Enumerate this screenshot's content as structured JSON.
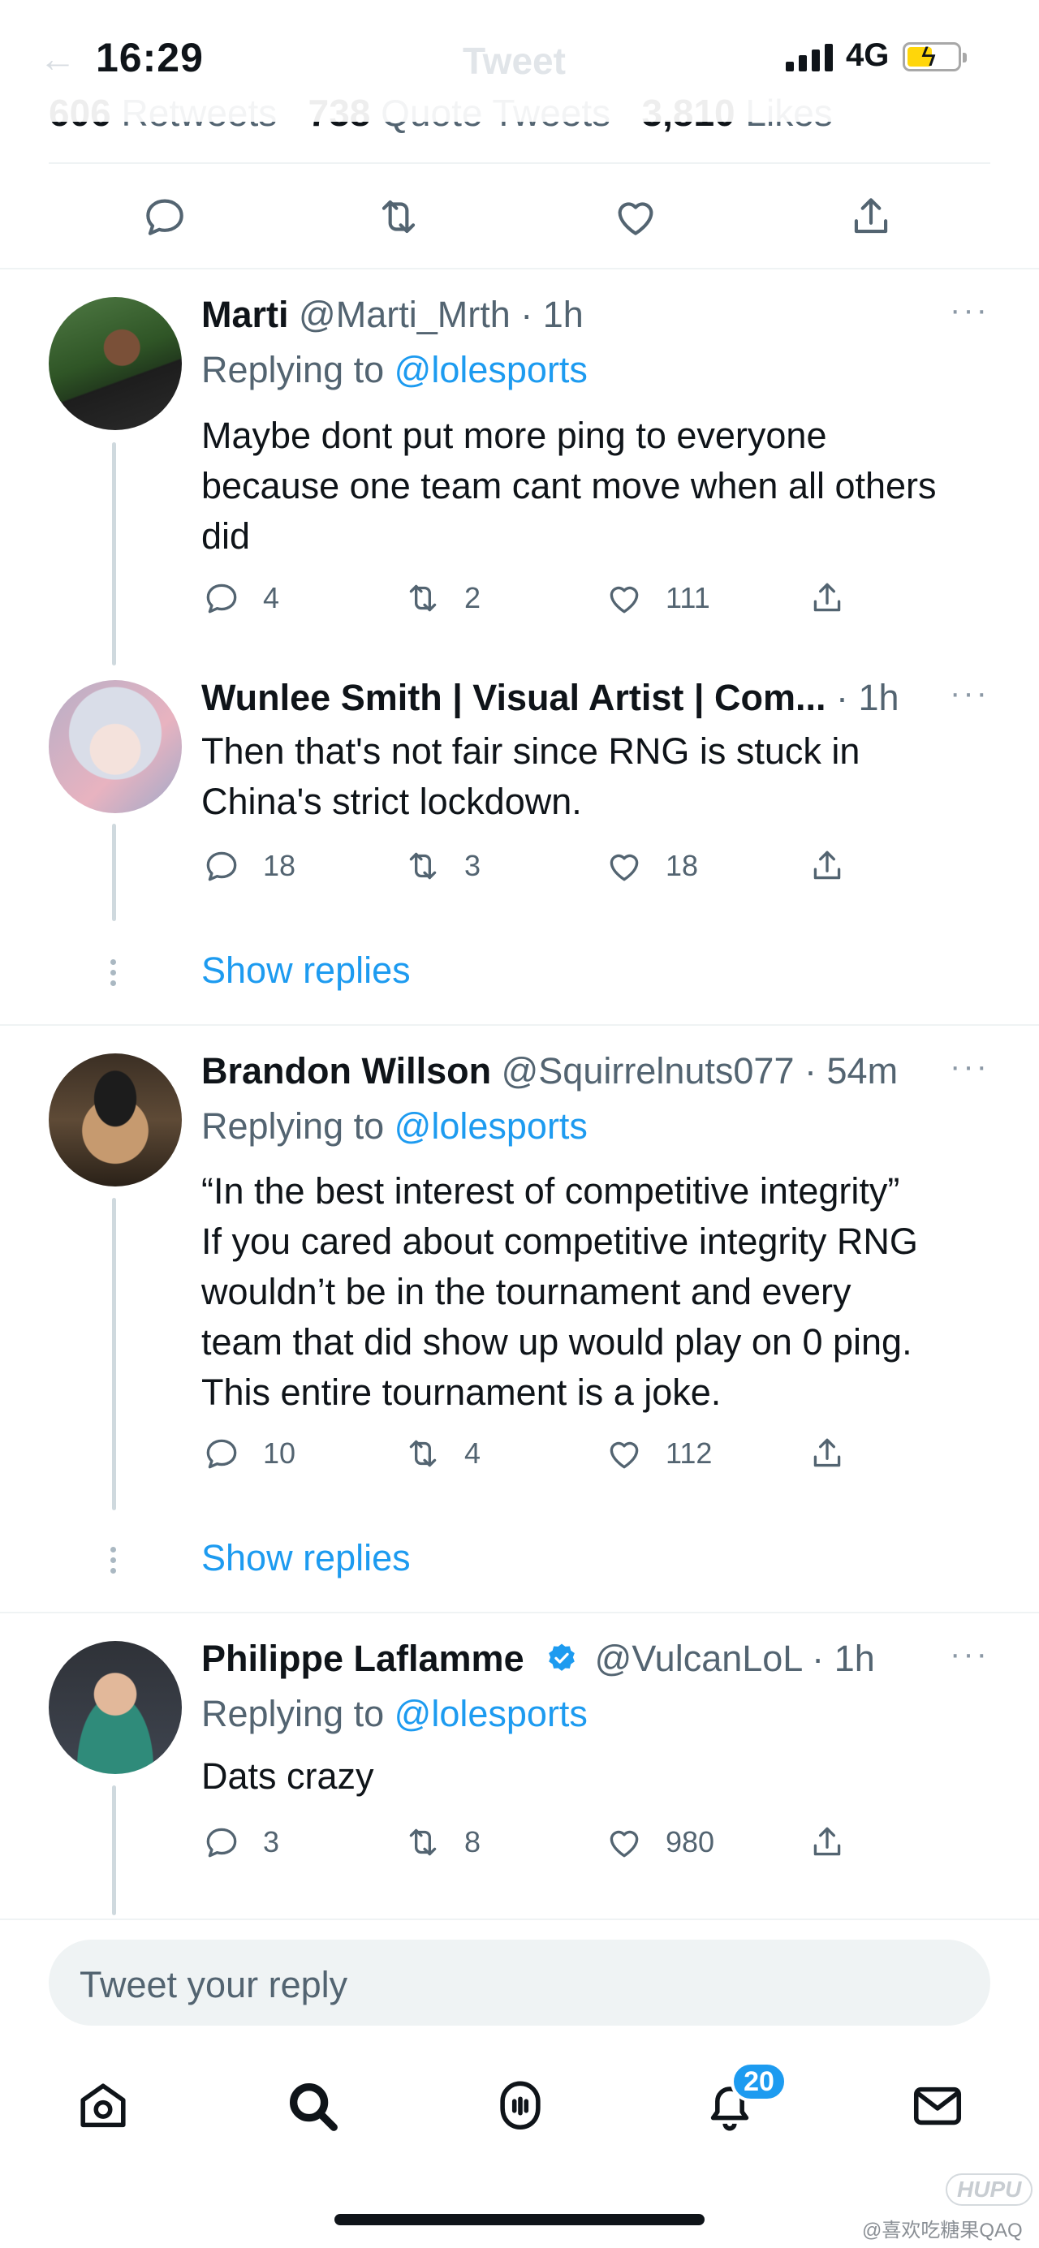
{
  "status_bar": {
    "time": "16:29",
    "network": "4G",
    "battery_icon": "battery-charging-icon"
  },
  "nav": {
    "title": "Tweet",
    "back_icon": "back-arrow-icon"
  },
  "stats": {
    "retweets_count": "606",
    "retweets_label": "Retweets",
    "quotes_count": "738",
    "quotes_label": "Quote Tweets",
    "likes_count": "3,810",
    "likes_label": "Likes"
  },
  "tweets": [
    {
      "name": "Marti",
      "handle": "@Marti_Mrth",
      "sep": "·",
      "time": "1h",
      "verified": false,
      "replying_label": "Replying to",
      "replying_to": "@lolesports",
      "text_lines": [
        "Maybe dont put more ping to everyone",
        "because one team cant move when all others",
        "did"
      ],
      "replies": "4",
      "retweets": "2",
      "likes": "111"
    },
    {
      "name": "Wunlee Smith | Visual Artist | Com...",
      "handle": "",
      "sep": "·",
      "time": "1h",
      "verified": false,
      "text_lines": [
        "Then that's not fair since RNG is stuck in",
        "China's strict lockdown."
      ],
      "replies": "18",
      "retweets": "3",
      "likes": "18"
    },
    {
      "name": "Brandon Willson",
      "handle": "@Squirrelnuts077",
      "sep": "·",
      "time": "54m",
      "verified": false,
      "replying_label": "Replying to",
      "replying_to": "@lolesports",
      "text_lines": [
        "“In the best interest of competitive integrity”",
        "If you cared about competitive integrity RNG",
        "wouldn’t be in the tournament and every",
        "team that did show up would play on 0 ping.",
        "This entire tournament is a joke."
      ],
      "replies": "10",
      "retweets": "4",
      "likes": "112"
    },
    {
      "name": "Philippe Laflamme",
      "handle": "@VulcanLoL",
      "sep": "·",
      "time": "1h",
      "verified": true,
      "replying_label": "Replying to",
      "replying_to": "@lolesports",
      "text_lines": [
        "Dats crazy"
      ],
      "replies": "3",
      "retweets": "8",
      "likes": "980"
    }
  ],
  "show_replies_label": "Show replies",
  "more_label": "···",
  "reply_box": {
    "placeholder": "Tweet your reply"
  },
  "tab_bar": {
    "icons": [
      "home-icon",
      "search-icon",
      "spaces-icon",
      "notifications-icon",
      "messages-icon"
    ],
    "notification_count": "20"
  },
  "watermark": {
    "logo_text": "HUPU",
    "text": "@喜欢吃糖果QAQ"
  },
  "colors": {
    "accent": "#1d9bf0",
    "text_primary": "#0f1419",
    "text_secondary": "#536471",
    "divider": "#eff3f4",
    "battery": "#ffd60a"
  }
}
